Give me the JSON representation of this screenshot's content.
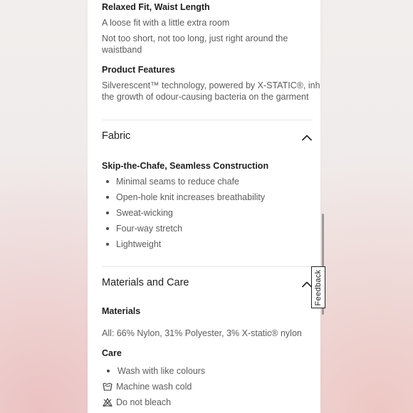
{
  "fit": {
    "heading": "Relaxed Fit, Waist Length",
    "lines": [
      "A loose fit with a little extra room",
      "Not too short, not too long, just right around the",
      "waistband"
    ]
  },
  "product_features": {
    "heading": "Product Features",
    "lines": [
      "Silverescent™ technology, powered by X-STATIC®, inhibits",
      "the growth of odour-causing bacteria on the garment"
    ]
  },
  "fabric": {
    "title": "Fabric",
    "subheading": "Skip-the-Chafe, Seamless Construction",
    "items": [
      "Minimal seams to reduce chafe",
      "Open-hole knit increases breathability",
      "Sweat-wicking",
      "Four-way stretch",
      "Lightweight"
    ]
  },
  "materials_care": {
    "title": "Materials and Care",
    "materials_heading": "Materials",
    "materials_text": "All: 66% Nylon, 31% Polyester, 3% X-static® nylon",
    "care_heading": "Care",
    "care_items": [
      {
        "icon": "bullet",
        "label": "Wash with like colours"
      },
      {
        "icon": "washtub-icon",
        "label": "Machine wash cold"
      },
      {
        "icon": "no-bleach-triangle-icon",
        "label": "Do not bleach"
      }
    ]
  },
  "feedback": {
    "label": "Feedback"
  },
  "colors": {
    "heading": "#1e1e1e",
    "body": "#5c5c5c",
    "divider": "#e6e6e6"
  }
}
